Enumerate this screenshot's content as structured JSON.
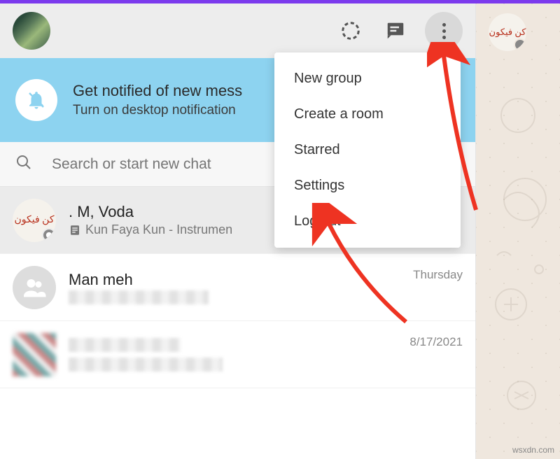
{
  "header": {
    "status_icon": "status-ring",
    "chat_icon": "chat-bubble",
    "more_icon": "more-vertical"
  },
  "notification": {
    "title": "Get notified of new mess",
    "subtitle": "Turn on desktop notification"
  },
  "search": {
    "placeholder": "Search or start new chat"
  },
  "menu": {
    "items": [
      "New group",
      "Create a room",
      "Starred",
      "Settings",
      "Log out"
    ]
  },
  "chats": [
    {
      "name": ". M, Voda",
      "message": "Kun Faya Kun - Instrumen",
      "time": "",
      "avatar": "arabic",
      "has_doc_icon": true
    },
    {
      "name": "Man meh",
      "message": "",
      "time": "Thursday",
      "avatar": "group",
      "has_doc_icon": false
    },
    {
      "name": "",
      "message": "",
      "time": "8/17/2021",
      "avatar": "blur",
      "has_doc_icon": false
    }
  ],
  "watermark": "wsxdn.com"
}
